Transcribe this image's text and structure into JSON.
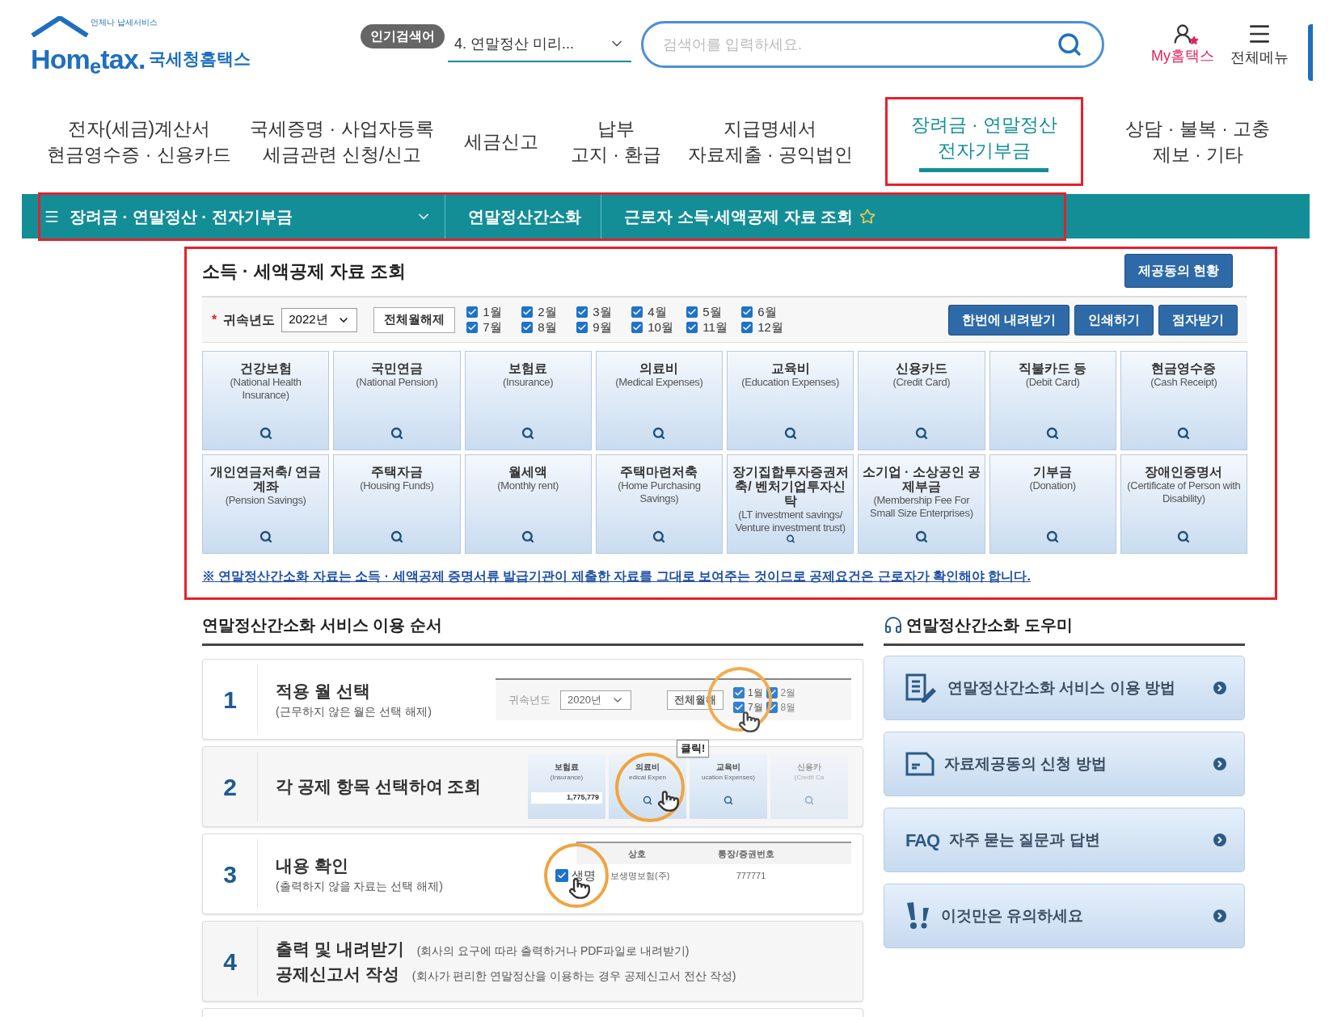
{
  "header": {
    "logo_tagline": "언제나 납세서비스",
    "logo_word": "Hom$_{e}$tax.",
    "logo_name": "국세청홈택스",
    "popular_badge": "인기검색어",
    "popular_term": "4. 연말정산 미리...",
    "search": {
      "placeholder": "검색어를 입력하세요."
    },
    "my_link": "My홈택스",
    "menu_link": "전체메뉴"
  },
  "nav": [
    {
      "lines": [
        "전자(세금)계산서",
        "현금영수증 · 신용카드"
      ],
      "selected": false
    },
    {
      "lines": [
        "국세증명 · 사업자등록",
        "세금관련 신청/신고"
      ],
      "selected": false
    },
    {
      "lines": [
        "세금신고"
      ],
      "selected": false
    },
    {
      "lines": [
        "납부",
        "고지 · 환급"
      ],
      "selected": false
    },
    {
      "lines": [
        "지급명세서",
        "자료제출 · 공익법인"
      ],
      "selected": false
    },
    {
      "lines": [
        "장려금 · 연말정산",
        "전자기부금"
      ],
      "selected": true
    },
    {
      "lines": [
        "상담 · 불복 · 고충",
        "제보 · 기타"
      ],
      "selected": false
    }
  ],
  "breadcrumb": [
    "장려금 · 연말정산 · 전자기부금",
    "연말정산간소화",
    "근로자 소득·세액공제 자료 조회"
  ],
  "section": {
    "title": "소득 · 세액공제 자료 조회",
    "consent_button": "제공동의 현황",
    "required_mark": "*",
    "year_label": "귀속년도",
    "year_value": "2022년",
    "clear_button": "전체월해제",
    "months": [
      {
        "label": "1월",
        "checked": true
      },
      {
        "label": "2월",
        "checked": true
      },
      {
        "label": "3월",
        "checked": true
      },
      {
        "label": "4월",
        "checked": true
      },
      {
        "label": "5월",
        "checked": true
      },
      {
        "label": "6월",
        "checked": true
      },
      {
        "label": "7월",
        "checked": true
      },
      {
        "label": "8월",
        "checked": true
      },
      {
        "label": "9월",
        "checked": true
      },
      {
        "label": "10월",
        "checked": true
      },
      {
        "label": "11월",
        "checked": true
      },
      {
        "label": "12월",
        "checked": true
      }
    ],
    "buttons": [
      "한번에 내려받기",
      "인쇄하기",
      "점자받기"
    ],
    "categories": [
      {
        "name": "건강보험",
        "english": "(National Health Insurance)"
      },
      {
        "name": "국민연금",
        "english": "(National Pension)"
      },
      {
        "name": "보험료",
        "english": "(Insurance)"
      },
      {
        "name": "의료비",
        "english": "(Medical Expenses)"
      },
      {
        "name": "교육비",
        "english": "(Education Expenses)"
      },
      {
        "name": "신용카드",
        "english": "(Credit Card)"
      },
      {
        "name": "직불카드 등",
        "english": "(Debit Card)"
      },
      {
        "name": "현금영수증",
        "english": "(Cash Receipt)"
      },
      {
        "name": "개인연금저축/ 연금계좌",
        "english": "(Pension Savings)"
      },
      {
        "name": "주택자금",
        "english": "(Housing Funds)"
      },
      {
        "name": "월세액",
        "english": "(Monthly rent)"
      },
      {
        "name": "주택마련저축",
        "english": "(Home Purchasing Savings)"
      },
      {
        "name": "장기집합투자증권저축/ 벤처기업투자신탁",
        "english": "(LT investment savings/ Venture investment trust)"
      },
      {
        "name": "소기업 · 소상공인 공제부금",
        "english": "(Membership Fee For Small Size Enterprises)"
      },
      {
        "name": "기부금",
        "english": "(Donation)"
      },
      {
        "name": "장애인증명서",
        "english": "(Certificate of Person with Disability)"
      }
    ],
    "notice": "※ 연말정산간소화 자료는 소득 · 세액공제 증명서류 발급기관이 제출한 자료를 그대로 보여주는 것이므로 공제요건은 근로자가 확인해야 합니다."
  },
  "steps": {
    "title": "연말정산간소화 서비스 이용 순서",
    "items": [
      {
        "number": "1",
        "lines": [
          {
            "title": "적용 월 선택",
            "note": "(근무하지 않은 월은 선택 해제)"
          }
        ],
        "illustration": {
          "kind": "months",
          "year_label": "귀속년도",
          "year": "2020년",
          "clear": "전체월해",
          "months": [
            {
              "label": "1월",
              "checked": true
            },
            {
              "label": "7월",
              "checked": true
            },
            {
              "label": "2월",
              "checked": true
            },
            {
              "label": "8월",
              "checked": true
            }
          ]
        }
      },
      {
        "number": "2",
        "lines": [
          {
            "title": "각 공제 항목 선택하여 조회"
          }
        ],
        "illustration": {
          "kind": "cards",
          "cards": [
            {
              "name": "보험료",
              "english": "(Insurance)",
              "amount": "1,775,779"
            },
            {
              "name": "의료비",
              "english": "edical Expen"
            },
            {
              "name": "교육비",
              "english": "ucation Expenses)"
            },
            {
              "name": "신용카",
              "english": "(Credit Ca"
            }
          ],
          "callout": "클릭!"
        }
      },
      {
        "number": "3",
        "lines": [
          {
            "title": "내용 확인",
            "note": "(출력하지 않을 자료는 선택 해제)"
          }
        ],
        "illustration": {
          "kind": "table",
          "headers": [
            "상호",
            "통장/증권번호"
          ],
          "checked": true,
          "cells": [
            "생명",
            "보생명보험(주)",
            "777771"
          ]
        }
      },
      {
        "number": "4",
        "lines": [
          {
            "title": "출력 및 내려받기",
            "note": "(회사의 요구에 따라 출력하거나 PDF파일로 내려받기)"
          },
          {
            "title": "공제신고서 작성",
            "note": "(회사가 편리한 연말정산을 이용하는 경우 공제신고서 전산 작성)"
          }
        ]
      }
    ]
  },
  "help": {
    "title": "연말정산간소화 도우미",
    "items": [
      {
        "kind": "guide",
        "label": "연말정산간소화 서비스 이용 방법"
      },
      {
        "kind": "consent",
        "label": "자료제공동의 신청 방법"
      },
      {
        "kind": "faq",
        "prefix": "FAQ",
        "label": "자주 묻는 질문과 답변"
      },
      {
        "kind": "caution",
        "label": "이것만은 유의하세요"
      }
    ]
  }
}
